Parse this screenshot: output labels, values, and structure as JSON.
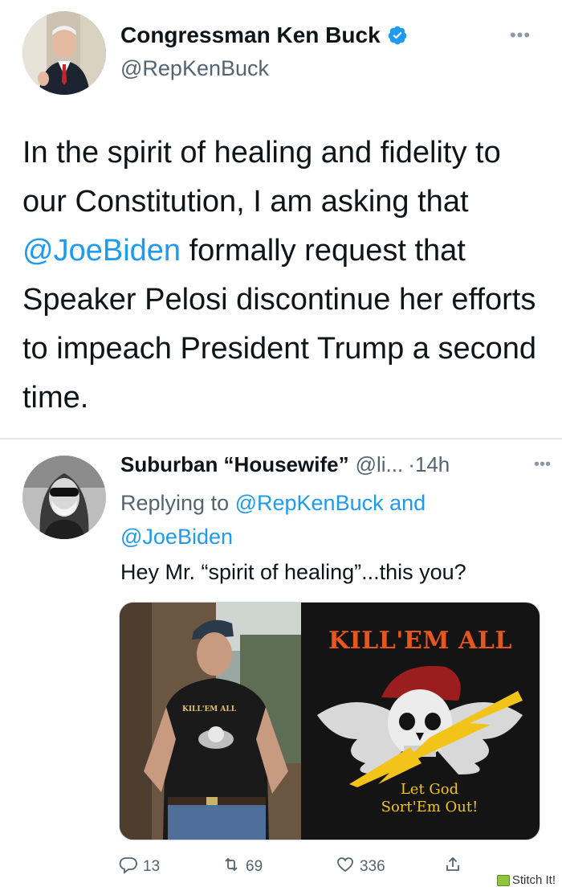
{
  "main_tweet": {
    "display_name": "Congressman Ken Buck",
    "handle": "@RepKenBuck",
    "text_line1": "In the spirit of healing and fidelity to our Constitution, I am asking that ",
    "text_mention": "@JoeBiden",
    "text_line2": " formally request that Speaker Pelosi discontinue her efforts to impeach President Trump a second time."
  },
  "reply_tweet": {
    "display_name": "Suburban “Housewife”",
    "handle": "@li...",
    "time": "·14h",
    "replying_prefix": "Replying to ",
    "replying_user1": "@RepKenBuck",
    "replying_and": " and",
    "replying_user2": "@JoeBiden",
    "text": "Hey Mr. “spirit of healing”...this you?",
    "media": {
      "banner_title": "KILL'EM ALL",
      "banner_motto_line1": "Let God",
      "banner_motto_line2": "Sort'Em Out!",
      "shirt_text": "KILL'EM ALL"
    },
    "actions": {
      "replies": "13",
      "retweets": "69",
      "likes": "336"
    }
  },
  "watermark": {
    "label": "Stitch It!"
  },
  "colors": {
    "link": "#1d9bf0",
    "secondary_text": "#536471",
    "verified": "#1d9bf0",
    "banner_orange": "#e7561d"
  },
  "icons": [
    "verified-badge-icon",
    "more-icon",
    "reply-icon",
    "retweet-icon",
    "like-icon",
    "share-icon"
  ]
}
